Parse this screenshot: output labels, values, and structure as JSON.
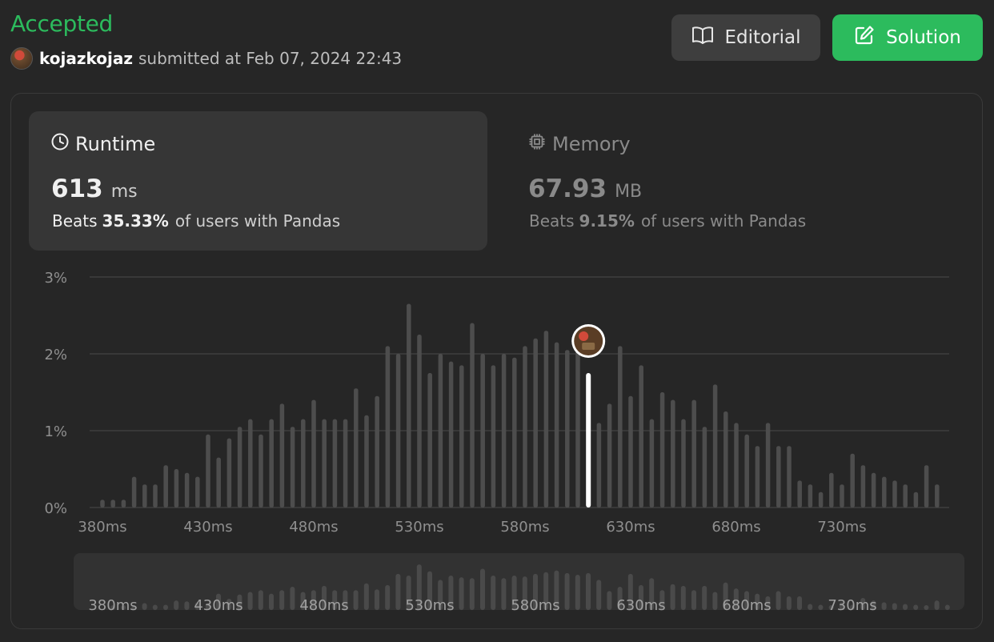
{
  "submission": {
    "status": "Accepted",
    "username": "kojazkojaz",
    "submitted_text": "submitted at Feb 07, 2024 22:43"
  },
  "buttons": {
    "editorial_label": "Editorial",
    "solution_label": "Solution"
  },
  "colors": {
    "accent_green": "#2cbb5d",
    "bar": "#4d4d4d",
    "bar_selected": "#ffffff",
    "card_bg": "#363636",
    "page_bg": "#262626"
  },
  "runtime": {
    "title": "Runtime",
    "value": "613",
    "unit": "ms",
    "beats_prefix": "Beats",
    "beats_percent": "35.33%",
    "beats_suffix": "of users with Pandas",
    "icon": "clock-icon"
  },
  "memory": {
    "title": "Memory",
    "value": "67.93",
    "unit": "MB",
    "beats_prefix": "Beats",
    "beats_percent": "9.15%",
    "beats_suffix": "of users with Pandas",
    "icon": "chip-icon"
  },
  "chart_data": {
    "type": "bar",
    "grid": true,
    "y_tick_labels": [
      "0%",
      "1%",
      "2%",
      "3%"
    ],
    "ylim": [
      0,
      3
    ],
    "x_tick_labels": [
      "380ms",
      "430ms",
      "480ms",
      "530ms",
      "580ms",
      "630ms",
      "680ms",
      "730ms"
    ],
    "x_ticks_ms": [
      380,
      430,
      480,
      530,
      580,
      630,
      680,
      730
    ],
    "bin_ms": 5,
    "x_start_ms": 380,
    "selected_ms": 610,
    "values": [
      0.1,
      0.1,
      0.1,
      0.4,
      0.3,
      0.3,
      0.55,
      0.5,
      0.45,
      0.4,
      0.95,
      0.65,
      0.9,
      1.05,
      1.15,
      0.95,
      1.15,
      1.35,
      1.05,
      1.15,
      1.4,
      1.15,
      1.15,
      1.15,
      1.55,
      1.2,
      1.45,
      2.1,
      2.0,
      2.65,
      2.25,
      1.75,
      2.0,
      1.9,
      1.85,
      2.4,
      2.0,
      1.85,
      2.0,
      1.95,
      2.1,
      2.2,
      2.3,
      2.15,
      2.05,
      2.15,
      1.75,
      1.1,
      1.35,
      2.1,
      1.45,
      1.85,
      1.15,
      1.5,
      1.4,
      1.15,
      1.4,
      1.05,
      1.6,
      1.25,
      1.1,
      0.95,
      0.8,
      1.1,
      0.8,
      0.8,
      0.35,
      0.3,
      0.2,
      0.45,
      0.3,
      0.7,
      0.55,
      0.45,
      0.4,
      0.35,
      0.3,
      0.2,
      0.55,
      0.3
    ]
  }
}
